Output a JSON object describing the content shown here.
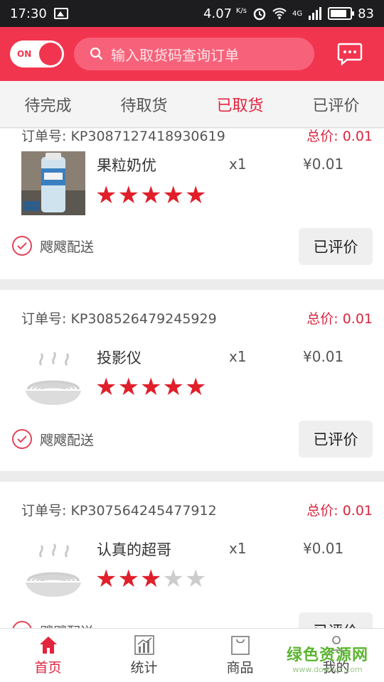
{
  "status_bar": {
    "time": "17:30",
    "speed": "4.07",
    "speed_unit": "K/s",
    "network": "4G",
    "battery": "83"
  },
  "header": {
    "toggle_label": "ON",
    "search_placeholder": "输入取货码查询订单"
  },
  "tabs": [
    {
      "label": "待完成",
      "active": false
    },
    {
      "label": "待取货",
      "active": false
    },
    {
      "label": "已取货",
      "active": true
    },
    {
      "label": "已评价",
      "active": false
    }
  ],
  "orders": [
    {
      "order_label": "订单号:",
      "order_no": "KP3087127418930619",
      "total_label": "总价:",
      "total": "0.01",
      "item_name": "果粒奶优",
      "qty": "x1",
      "price": "¥0.01",
      "rating": 5,
      "delivery": "飕飕配送",
      "button": "已评价",
      "thumb": "photo"
    },
    {
      "order_label": "订单号:",
      "order_no": "KP308526479245929",
      "total_label": "总价:",
      "total": "0.01",
      "item_name": "投影仪",
      "qty": "x1",
      "price": "¥0.01",
      "rating": 5,
      "delivery": "飕飕配送",
      "button": "已评价",
      "thumb": "noodle-placeholder"
    },
    {
      "order_label": "订单号:",
      "order_no": "KP307564245477912",
      "total_label": "总价:",
      "total": "0.01",
      "item_name": "认真的超哥",
      "qty": "x1",
      "price": "¥0.01",
      "rating": 3,
      "delivery": "飕飕配送",
      "button": "已评价",
      "thumb": "noodle-placeholder"
    }
  ],
  "bottom_nav": [
    {
      "label": "首页",
      "icon": "home-icon",
      "active": true
    },
    {
      "label": "统计",
      "icon": "chart-icon",
      "active": false
    },
    {
      "label": "商品",
      "icon": "bag-icon",
      "active": false
    },
    {
      "label": "我的",
      "icon": "user-icon",
      "active": false
    }
  ],
  "watermark": {
    "main": "绿色资源网",
    "sub": "www.downcc.com"
  },
  "colors": {
    "brand": "#f2354f",
    "star_on": "#e01f2a",
    "star_off": "#cccccc"
  }
}
